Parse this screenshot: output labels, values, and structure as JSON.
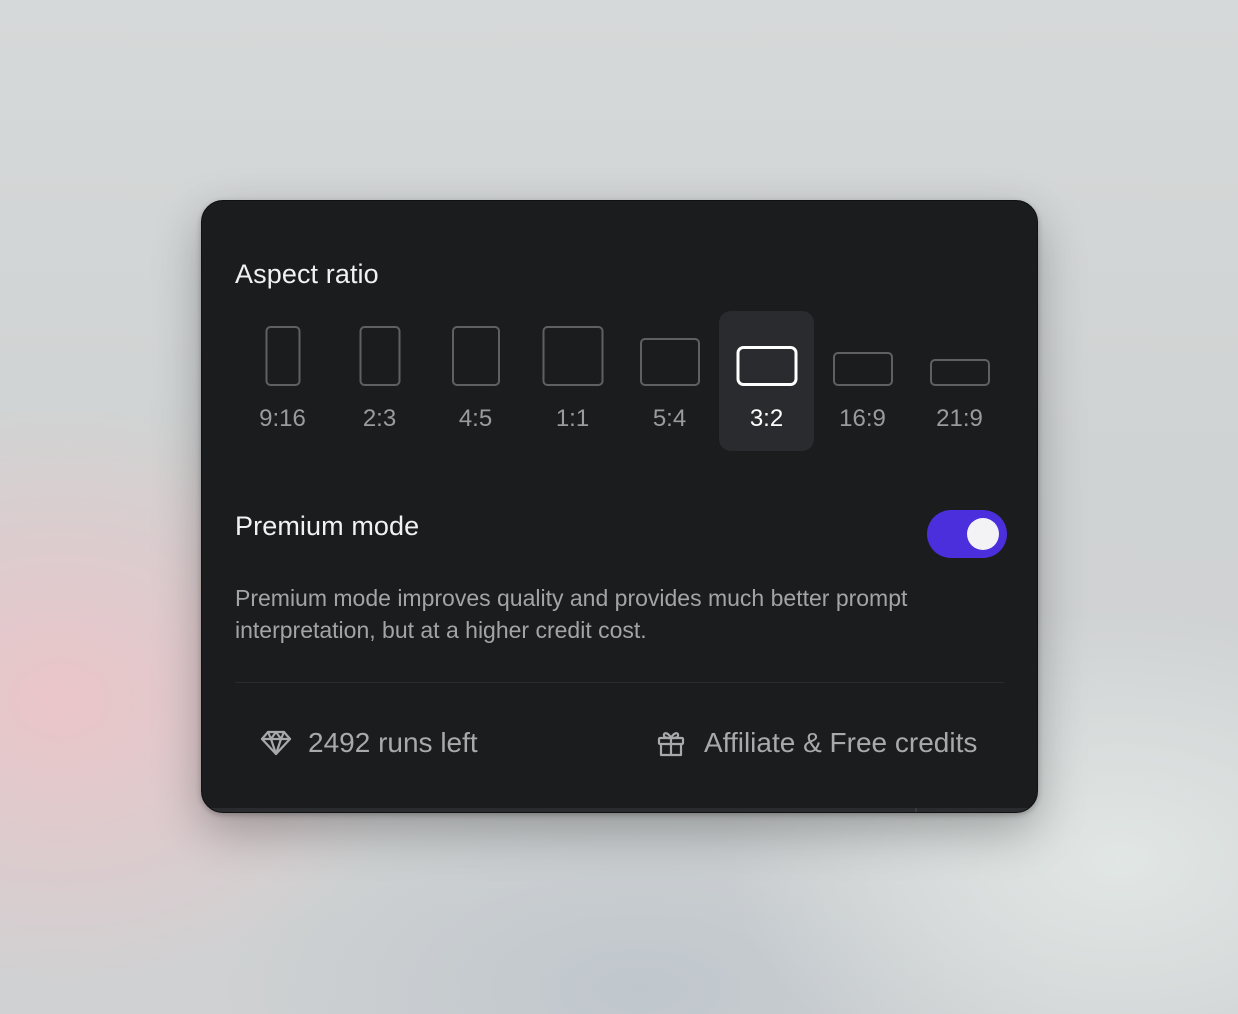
{
  "aspect_ratio": {
    "title": "Aspect ratio",
    "selected": "3:2",
    "options": [
      {
        "label": "9:16"
      },
      {
        "label": "2:3"
      },
      {
        "label": "4:5"
      },
      {
        "label": "1:1"
      },
      {
        "label": "5:4"
      },
      {
        "label": "3:2"
      },
      {
        "label": "16:9"
      },
      {
        "label": "21:9"
      }
    ]
  },
  "premium_mode": {
    "title": "Premium mode",
    "enabled": true,
    "description": "Premium mode improves quality and provides much better prompt interpretation, but at a higher credit cost."
  },
  "footer": {
    "runs_left": "2492 runs left",
    "runs_icon": "diamond-icon",
    "affiliate_label": "Affiliate & Free credits",
    "affiliate_icon": "gift-icon"
  },
  "colors": {
    "panel_background": "#1b1c1e",
    "toggle_on": "#4b2fdc",
    "selected_tile": "#2a2b2e"
  }
}
